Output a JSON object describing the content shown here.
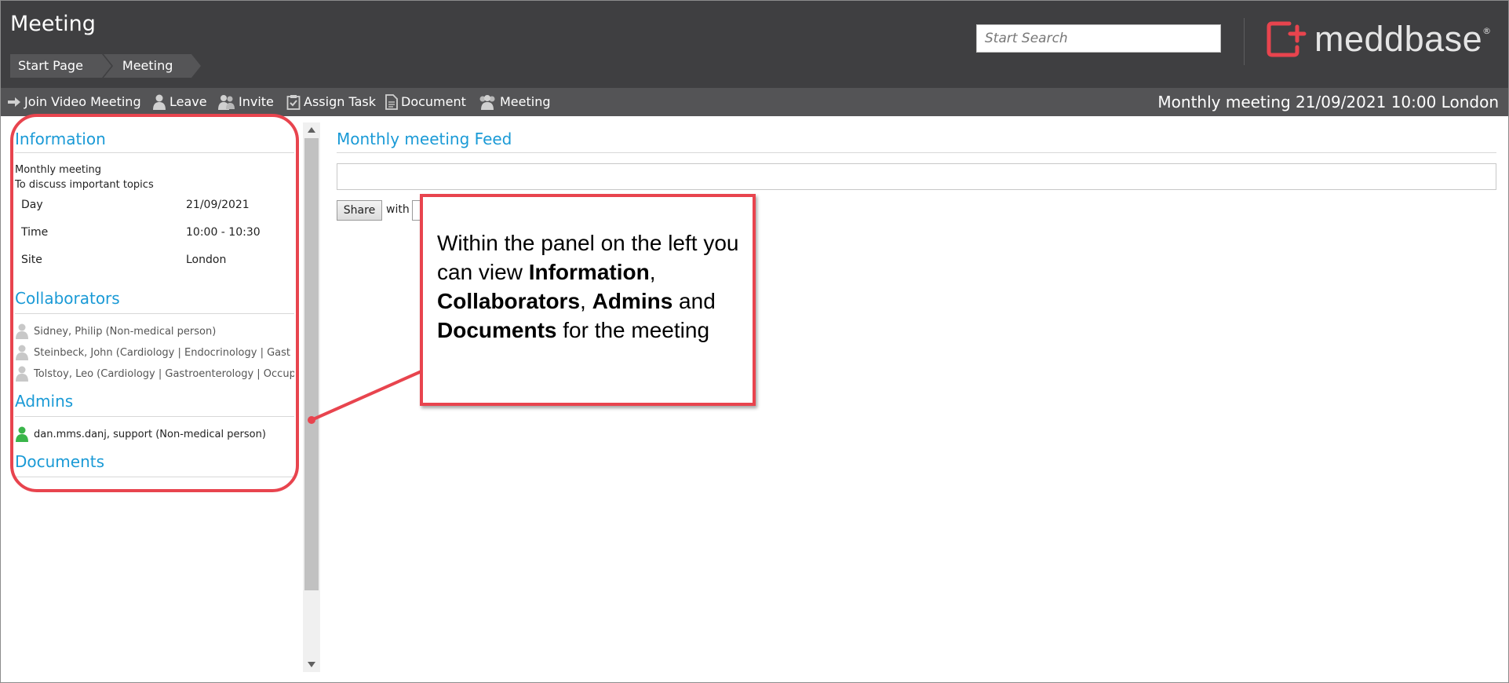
{
  "header": {
    "title": "Meeting",
    "breadcrumb": [
      "Start Page",
      "Meeting"
    ],
    "search_placeholder": "Start Search",
    "logo_text": "meddbase",
    "logo_mark": "®",
    "colors": {
      "header_bg": "#3f3f41",
      "toolbar_bg": "#545456",
      "accent": "#1a9ad6",
      "logo_red": "#e8444e"
    }
  },
  "toolbar": {
    "items": [
      {
        "label": "Join Video Meeting",
        "icon": "arrow-right-icon"
      },
      {
        "label": "Leave",
        "icon": "person-icon"
      },
      {
        "label": "Invite",
        "icon": "add-people-icon"
      },
      {
        "label": "Assign Task",
        "icon": "clipboard-check-icon"
      },
      {
        "label": "Document",
        "icon": "document-icon"
      },
      {
        "label": "Meeting",
        "icon": "group-icon"
      }
    ],
    "meeting_summary": "Monthly meeting 21/09/2021 10:00 London"
  },
  "information": {
    "heading": "Information",
    "name": "Monthly meeting",
    "description": "To discuss important topics",
    "rows": [
      {
        "label": "Day",
        "value": "21/09/2021"
      },
      {
        "label": "Time",
        "value": "10:00 - 10:30"
      },
      {
        "label": "Site",
        "value": "London"
      }
    ]
  },
  "collaborators": {
    "heading": "Collaborators",
    "people": [
      "Sidney, Philip (Non-medical person)",
      "Steinbeck, John (Cardiology | Endocrinology | Gast",
      "Tolstoy, Leo (Cardiology | Gastroenterology | Occup"
    ]
  },
  "admins": {
    "heading": "Admins",
    "people": [
      "dan.mms.danj, support (Non-medical person)"
    ]
  },
  "documents": {
    "heading": "Documents"
  },
  "feed": {
    "title": "Monthly meeting Feed",
    "share_label": "Share",
    "with_label": "with"
  },
  "callout": {
    "parts": [
      {
        "text": "Within the panel on the left you can view ",
        "bold": false
      },
      {
        "text": "Information",
        "bold": true
      },
      {
        "text": ", ",
        "bold": false
      },
      {
        "text": "Collaborators",
        "bold": true
      },
      {
        "text": ", ",
        "bold": false
      },
      {
        "text": "Admins",
        "bold": true
      },
      {
        "text": " and ",
        "bold": false
      },
      {
        "text": "Documents",
        "bold": true
      },
      {
        "text": " for the meeting",
        "bold": false
      }
    ]
  }
}
